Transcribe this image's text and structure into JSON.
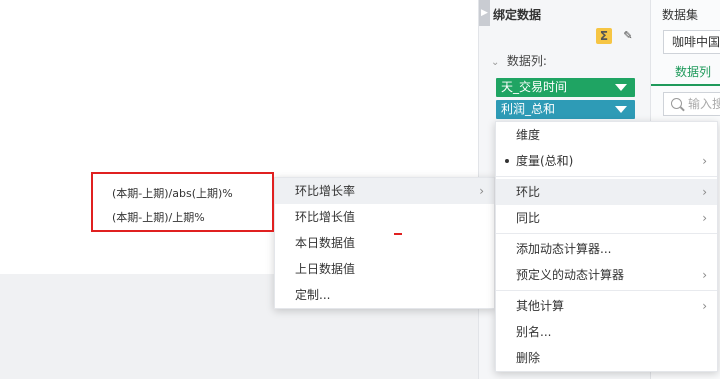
{
  "bind_panel": {
    "title": "绑定数据",
    "sum_icon_glyph": "Σ",
    "eraser_icon_glyph": "✎",
    "data_columns_label": "数据列:",
    "fields": [
      {
        "label": "天_交易时间",
        "color": "#1fa463"
      },
      {
        "label": "利润_总和",
        "color": "#2e9bb6"
      }
    ]
  },
  "dataset_panel": {
    "title": "数据集",
    "selected_dataset": "咖啡中国",
    "tab_label": "数据列",
    "search_placeholder": "输入搜索"
  },
  "context_menu": {
    "items": [
      {
        "label": "维度",
        "has_submenu": false,
        "bullet": false
      },
      {
        "label": "度量(总和)",
        "has_submenu": true,
        "bullet": true
      },
      {
        "label": "环比",
        "has_submenu": true,
        "active": true
      },
      {
        "label": "同比",
        "has_submenu": true
      },
      {
        "label": "添加动态计算器...",
        "has_submenu": false
      },
      {
        "label": "预定义的动态计算器",
        "has_submenu": true
      },
      {
        "label": "其他计算",
        "has_submenu": true
      },
      {
        "label": "别名...",
        "has_submenu": false
      },
      {
        "label": "删除",
        "has_submenu": false
      }
    ]
  },
  "sub_menu": {
    "items": [
      {
        "label": "环比增长率",
        "has_submenu": true,
        "active": true
      },
      {
        "label": "环比增长值"
      },
      {
        "label": "本日数据值"
      },
      {
        "label": "上日数据值"
      },
      {
        "label": "定制..."
      }
    ]
  },
  "formula_menu": {
    "items": [
      "(本期-上期)/abs(上期)%",
      "(本期-上期)/上期%"
    ]
  },
  "colors": {
    "accent_green": "#1f9a5b",
    "highlight_red": "#e02020"
  },
  "chevron_glyph": "›"
}
